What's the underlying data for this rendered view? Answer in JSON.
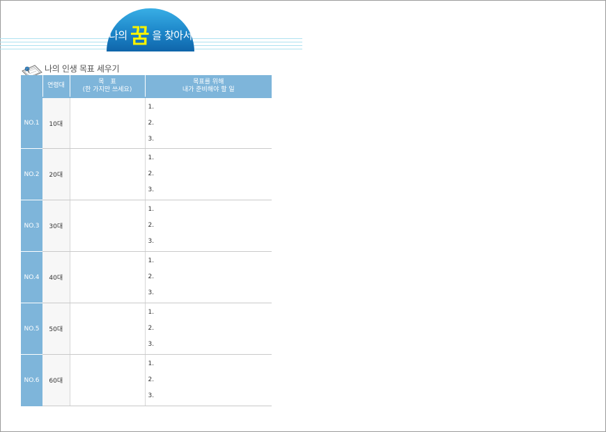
{
  "header": {
    "title_pre": "나의",
    "title_big": "꿈",
    "title_post": "을 찾아서"
  },
  "section": {
    "title": "나의 인생 목표 세우기",
    "icon": "pushpin-note-icon"
  },
  "table": {
    "columns": [
      {
        "label": "",
        "label2": ""
      },
      {
        "label": "연령대",
        "label2": ""
      },
      {
        "label": "목　표",
        "label2": "(한 가지만 쓰세요)"
      },
      {
        "label": "목표를 위해",
        "label2": "내가 준비해야 할 일"
      }
    ],
    "rows": [
      {
        "no": "NO.1",
        "age": "10대",
        "goal": "",
        "items": [
          "1.",
          "2.",
          "3."
        ]
      },
      {
        "no": "NO.2",
        "age": "20대",
        "goal": "",
        "items": [
          "1.",
          "2.",
          "3."
        ]
      },
      {
        "no": "NO.3",
        "age": "30대",
        "goal": "",
        "items": [
          "1.",
          "2.",
          "3."
        ]
      },
      {
        "no": "NO.4",
        "age": "40대",
        "goal": "",
        "items": [
          "1.",
          "2.",
          "3."
        ]
      },
      {
        "no": "NO.5",
        "age": "50대",
        "goal": "",
        "items": [
          "1.",
          "2.",
          "3."
        ]
      },
      {
        "no": "NO.6",
        "age": "60대",
        "goal": "",
        "items": [
          "1.",
          "2.",
          "3."
        ]
      }
    ]
  },
  "colors": {
    "header_blue": "#1d86c9",
    "table_blue": "#7eb5da",
    "highlight_yellow": "#f7f200"
  }
}
